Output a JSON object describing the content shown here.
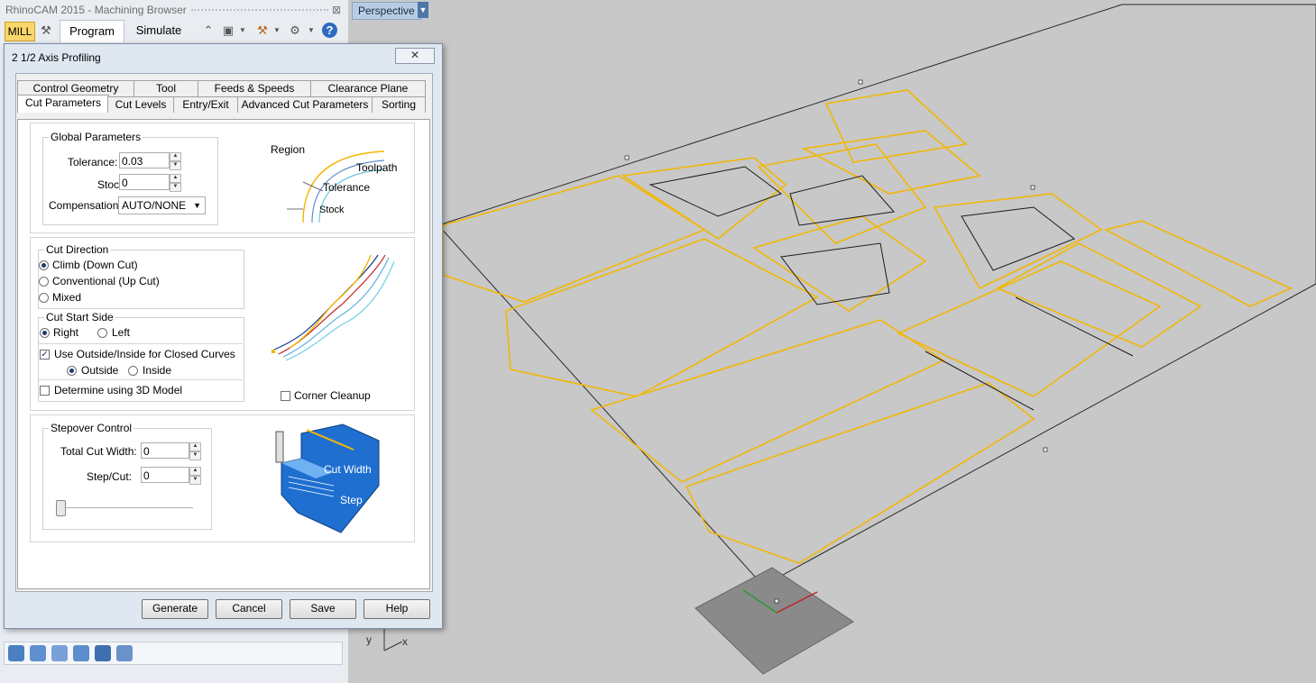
{
  "browser": {
    "title": "RhinoCAM 2015 - Machining Browser",
    "close_glyph": "⊠",
    "mode": "MILL",
    "tabs": [
      "Program",
      "Simulate"
    ]
  },
  "viewport": {
    "label": "Perspective",
    "axis_x": "x",
    "axis_y": "y"
  },
  "dialog": {
    "title": "2 1/2 Axis Profiling",
    "close_glyph": "✕",
    "tabs_row1": [
      "Control Geometry",
      "Tool",
      "Feeds & Speeds",
      "Clearance Plane"
    ],
    "tabs_row2": [
      "Cut Parameters",
      "Cut Levels",
      "Entry/Exit",
      "Advanced Cut Parameters",
      "Sorting"
    ],
    "global": {
      "title": "Global Parameters",
      "tolerance_label": "Tolerance:",
      "tolerance_value": "0.03",
      "stock_label": "Stock:",
      "stock_value": "0",
      "compensation_label": "Compensation:",
      "compensation_value": "AUTO/NONE",
      "diagram_region": "Region",
      "diagram_toolpath": "Toolpath",
      "diagram_tolerance": "Tolerance",
      "diagram_stock": "Stock"
    },
    "cut_direction": {
      "title": "Cut Direction",
      "options": [
        "Climb (Down Cut)",
        "Conventional (Up Cut)",
        "Mixed"
      ],
      "selected": "Climb (Down Cut)"
    },
    "cut_start_side": {
      "title": "Cut Start Side",
      "right": "Right",
      "left": "Left",
      "use_outside_inside": "Use Outside/Inside for Closed Curves",
      "outside": "Outside",
      "inside": "Inside",
      "determine_3d": "Determine using 3D Model",
      "corner_cleanup": "Corner Cleanup"
    },
    "stepover": {
      "title": "Stepover Control",
      "total_cut_width_label": "Total Cut Width:",
      "total_cut_width_value": "0",
      "step_cut_label": "Step/Cut:",
      "step_cut_value": "0",
      "diagram_cut_width": "Cut Width",
      "diagram_step": "Step"
    },
    "buttons": {
      "generate": "Generate",
      "cancel": "Cancel",
      "save": "Save",
      "help": "Help"
    }
  },
  "colors": {
    "toolpath": "#f2b705",
    "viewport_bg": "#c8c8c8",
    "dialog_bg": "#dfe7f1",
    "diagram_blue": "#1f6fd0"
  }
}
